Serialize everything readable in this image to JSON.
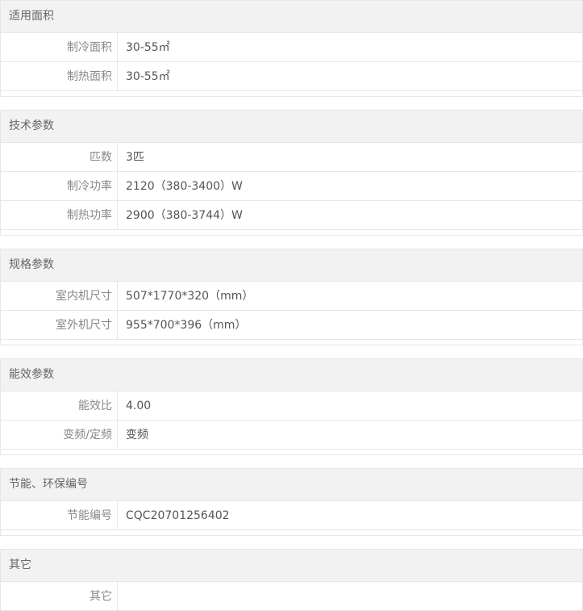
{
  "sections": [
    {
      "title": "适用面积",
      "rows": [
        {
          "label": "制冷面积",
          "value": "30-55㎡"
        },
        {
          "label": "制热面积",
          "value": "30-55㎡"
        }
      ]
    },
    {
      "title": "技术参数",
      "rows": [
        {
          "label": "匹数",
          "value": "3匹"
        },
        {
          "label": "制冷功率",
          "value": "2120（380-3400）W"
        },
        {
          "label": "制热功率",
          "value": "2900（380-3744）W"
        }
      ]
    },
    {
      "title": "规格参数",
      "rows": [
        {
          "label": "室内机尺寸",
          "value": "507*1770*320（mm）"
        },
        {
          "label": "室外机尺寸",
          "value": "955*700*396（mm）"
        }
      ]
    },
    {
      "title": "能效参数",
      "rows": [
        {
          "label": "能效比",
          "value": "4.00"
        },
        {
          "label": "变频/定频",
          "value": "变频"
        }
      ]
    },
    {
      "title": "节能、环保编号",
      "rows": [
        {
          "label": "节能编号",
          "value": "CQC20701256402"
        }
      ]
    },
    {
      "title": "其它",
      "rows": [
        {
          "label": "其它",
          "value": ""
        }
      ]
    }
  ]
}
